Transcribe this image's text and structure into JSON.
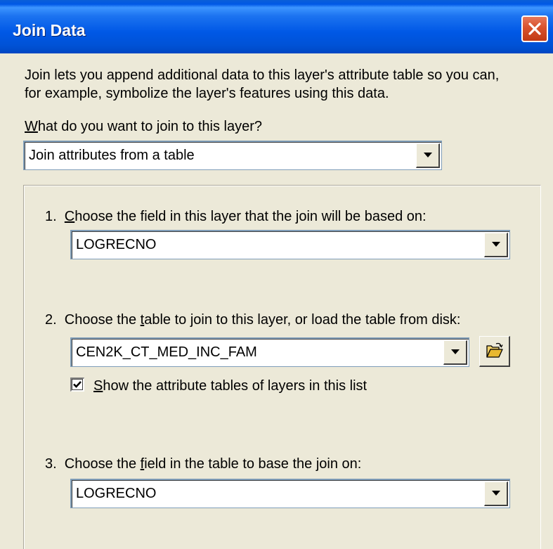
{
  "dialog": {
    "title": "Join Data"
  },
  "intro": {
    "line1": "Join lets you append additional data to this layer's attribute table so you can,",
    "line2": "for example, symbolize the layer's features using this data."
  },
  "join_type": {
    "question_mnemonic": "W",
    "question_rest": "hat do you want to join to this layer?",
    "selected": "Join attributes from a table"
  },
  "step1": {
    "prefix": "1.  ",
    "mnemonic": "C",
    "rest": "hoose the field in this layer that the join will be based on:",
    "selected": "LOGRECNO"
  },
  "step2": {
    "prefix": "2.  Choose the ",
    "mnemonic": "t",
    "rest": "able to join to this layer, or load the table from disk:",
    "selected": "CEN2K_CT_MED_INC_FAM",
    "checkbox_mnemonic": "S",
    "checkbox_rest": "how the attribute tables of layers in this list",
    "checkbox_checked": true
  },
  "step3": {
    "prefix": "3.  Choose the ",
    "mnemonic": "f",
    "rest": "ield in the table to base the join on:",
    "selected": "LOGRECNO"
  },
  "icons": {
    "close": "close-icon",
    "dropdown": "chevron-down-icon",
    "browse": "open-folder-icon",
    "check": "check-icon"
  }
}
